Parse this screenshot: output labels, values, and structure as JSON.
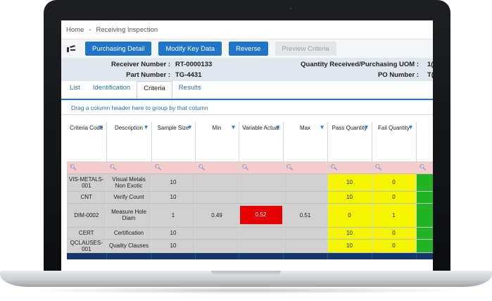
{
  "breadcrumb": {
    "home": "Home",
    "separator": "-",
    "current": "Receiving Inspection"
  },
  "toolbar": {
    "icon": "user-edit-icon",
    "buttons": [
      "Purchasing Detail",
      "Modify Key Data",
      "Reverse",
      "Preview Criteria"
    ]
  },
  "info": {
    "receiver_label": "Receiver Number :",
    "receiver_value": "RT-0000133",
    "part_label": "Part Number :",
    "part_value": "TG-4431",
    "qty_label": "Quantity Received/Purchasing UOM :",
    "qty_value": "1(",
    "po_label": "PO Number :",
    "po_value": "T("
  },
  "tabs": [
    "List",
    "Identification",
    "Criteria",
    "Results"
  ],
  "active_tab": "Criteria",
  "grid": {
    "group_hint": "Drag a column header here to group by that column",
    "columns": [
      "Criteria Code",
      "Description",
      "Sample Size",
      "Min",
      "Variable Actual",
      "Max",
      "Pass Quantity",
      "Fail Quantity"
    ],
    "search_icon": "search-icon",
    "filter_icon": "filter-icon",
    "rows": [
      {
        "code": "VIS-METALS-001",
        "desc": "Visual Metals Non Exotic",
        "sample": "10",
        "min": "",
        "actual": "",
        "max": "",
        "pass": "10",
        "fail": "0"
      },
      {
        "code": "CNT",
        "desc": "Verify Count",
        "sample": "10",
        "min": "",
        "actual": "",
        "max": "",
        "pass": "10",
        "fail": "0"
      },
      {
        "code": "DIM-0002",
        "desc": "Measure Hole Diam",
        "sample": "1",
        "min": "0.49",
        "actual": "0.52",
        "max": "0.51",
        "pass": "0",
        "fail": "1"
      },
      {
        "code": "CERT",
        "desc": "Certification",
        "sample": "10",
        "min": "",
        "actual": "",
        "max": "",
        "pass": "10",
        "fail": "0"
      },
      {
        "code": "QCLAUSES-001",
        "desc": "Quality Clauses",
        "sample": "10",
        "min": "",
        "actual": "",
        "max": "",
        "pass": "10",
        "fail": "0"
      }
    ]
  },
  "colors": {
    "accent": "#1f75c9",
    "pass_fill": "#f5f500",
    "fail_actual": "#e60000",
    "row_fill": "#d0d0d0",
    "search_row": "#f5cccc"
  }
}
